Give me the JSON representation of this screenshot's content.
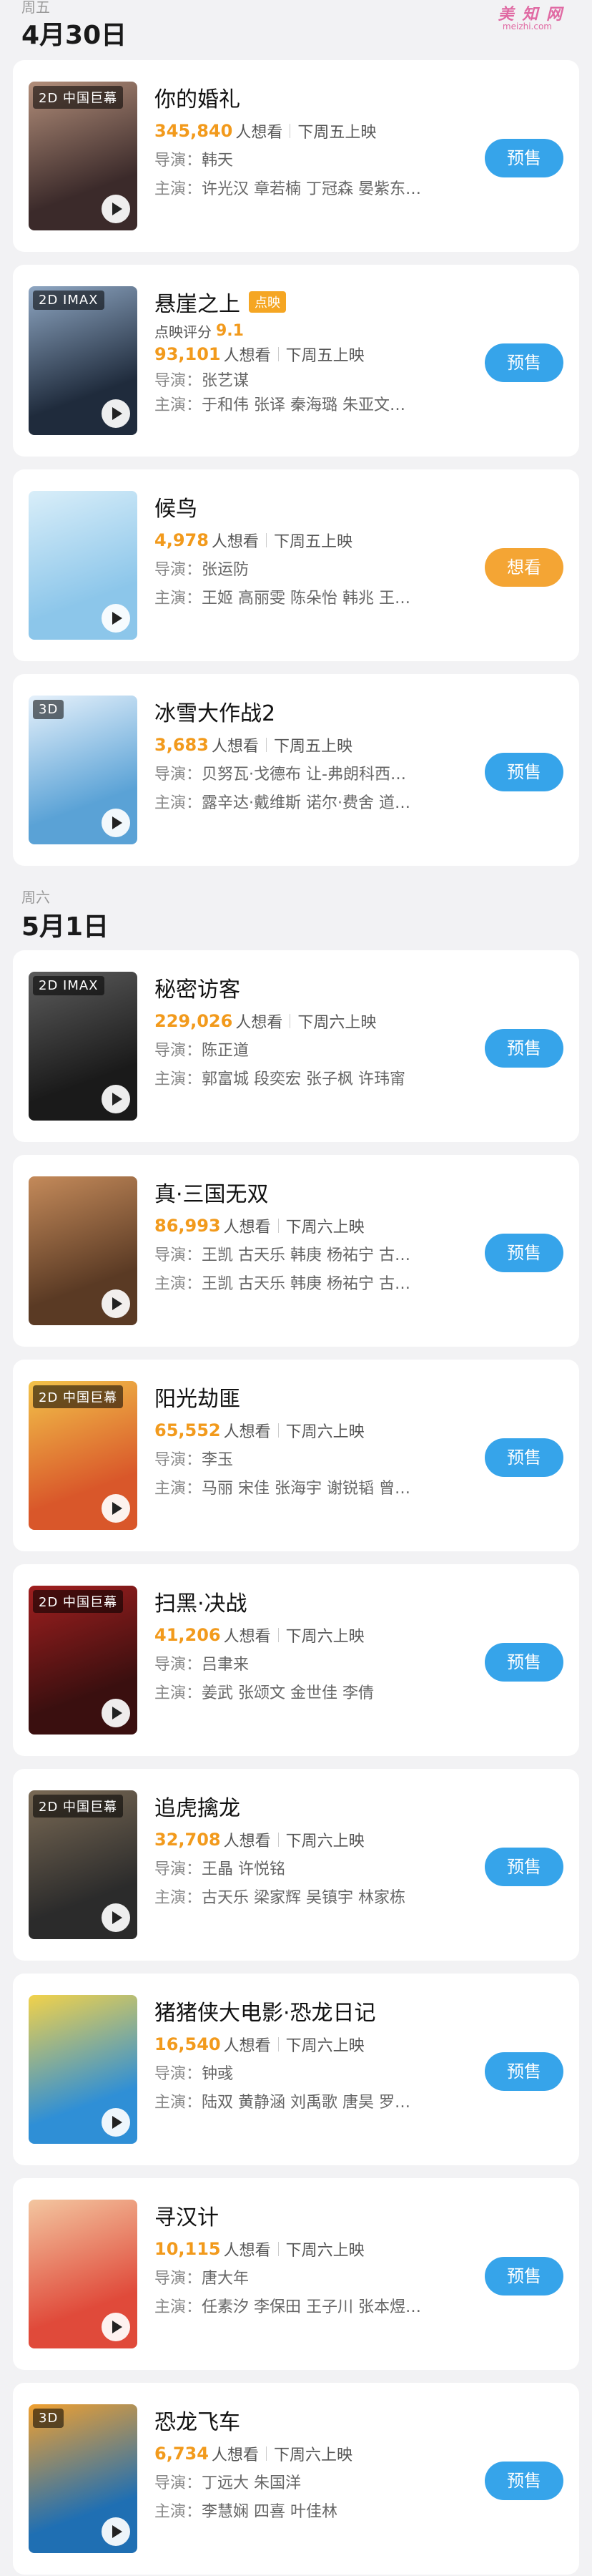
{
  "watermark": {
    "main": "美 知 网",
    "sub": "meizhi.com"
  },
  "days": [
    {
      "weekday": "周五",
      "date": "4月30日",
      "movies": [
        {
          "title": "你的婚礼",
          "badge": "2D 中国巨幕",
          "tag": "",
          "score_label": "",
          "score": "",
          "want_count": "345,840",
          "want_suffix": "人想看",
          "release": "下周五上映",
          "director_label": "导演：",
          "director": "韩天",
          "cast_label": "主演：",
          "cast": "许光汉 章若楠 丁冠森 晏紫东…",
          "button": "预售",
          "poster_colors": [
            "#3b2a2a",
            "#b28e7a"
          ]
        },
        {
          "title": "悬崖之上",
          "badge": "2D IMAX",
          "tag": "点映",
          "score_label": "点映评分",
          "score": "9.1",
          "want_count": "93,101",
          "want_suffix": "人想看",
          "release": "下周五上映",
          "director_label": "导演：",
          "director": "张艺谋",
          "cast_label": "主演：",
          "cast": "于和伟 张译 秦海璐 朱亚文…",
          "button": "预售",
          "poster_colors": [
            "#1f2b3c",
            "#8ea6c2"
          ]
        },
        {
          "title": "候鸟",
          "badge": "",
          "tag": "",
          "score_label": "",
          "score": "",
          "want_count": "4,978",
          "want_suffix": "人想看",
          "release": "下周五上映",
          "director_label": "导演：",
          "director": "张运防",
          "cast_label": "主演：",
          "cast": "王姬 高丽雯 陈朵怡 韩兆 王…",
          "button": "想看",
          "poster_colors": [
            "#8cc6ea",
            "#d9eef9"
          ]
        },
        {
          "title": "冰雪大作战2",
          "badge": "3D",
          "tag": "",
          "score_label": "",
          "score": "",
          "want_count": "3,683",
          "want_suffix": "人想看",
          "release": "下周五上映",
          "director_label": "导演：",
          "director": "贝努瓦·戈德布 让-弗朗科西…",
          "cast_label": "主演：",
          "cast": "露辛达·戴维斯 诺尔·费舍 道…",
          "button": "预售",
          "poster_colors": [
            "#5aa2d6",
            "#e6f1fb"
          ]
        }
      ]
    },
    {
      "weekday": "周六",
      "date": "5月1日",
      "movies": [
        {
          "title": "秘密访客",
          "badge": "2D IMAX",
          "tag": "",
          "score_label": "",
          "score": "",
          "want_count": "229,026",
          "want_suffix": "人想看",
          "release": "下周六上映",
          "director_label": "导演：",
          "director": "陈正道",
          "cast_label": "主演：",
          "cast": "郭富城 段奕宏 张子枫 许玮甯",
          "button": "预售",
          "poster_colors": [
            "#1a1a1a",
            "#5c5c5c"
          ]
        },
        {
          "title": "真·三国无双",
          "badge": "",
          "tag": "",
          "score_label": "",
          "score": "",
          "want_count": "86,993",
          "want_suffix": "人想看",
          "release": "下周六上映",
          "director_label": "导演：",
          "director": "王凯 古天乐 韩庚 杨祐宁 古…",
          "cast_label": "主演：",
          "cast": "王凯 古天乐 韩庚 杨祐宁 古…",
          "button": "预售",
          "poster_colors": [
            "#5a3a24",
            "#c48a5a"
          ]
        },
        {
          "title": "阳光劫匪",
          "badge": "2D 中国巨幕",
          "tag": "",
          "score_label": "",
          "score": "",
          "want_count": "65,552",
          "want_suffix": "人想看",
          "release": "下周六上映",
          "director_label": "导演：",
          "director": "李玉",
          "cast_label": "主演：",
          "cast": "马丽 宋佳 张海宇 谢锐韬 曾…",
          "button": "预售",
          "poster_colors": [
            "#d9572a",
            "#f2c34a"
          ]
        },
        {
          "title": "扫黑·决战",
          "badge": "2D 中国巨幕",
          "tag": "",
          "score_label": "",
          "score": "",
          "want_count": "41,206",
          "want_suffix": "人想看",
          "release": "下周六上映",
          "director_label": "导演：",
          "director": "吕聿来",
          "cast_label": "主演：",
          "cast": "姜武 张颂文 金世佳 李倩",
          "button": "预售",
          "poster_colors": [
            "#3a0f0f",
            "#a01f1f"
          ]
        },
        {
          "title": "追虎擒龙",
          "badge": "2D 中国巨幕",
          "tag": "",
          "score_label": "",
          "score": "",
          "want_count": "32,708",
          "want_suffix": "人想看",
          "release": "下周六上映",
          "director_label": "导演：",
          "director": "王晶 许悦铭",
          "cast_label": "主演：",
          "cast": "古天乐 梁家辉 吴镇宇 林家栋",
          "button": "预售",
          "poster_colors": [
            "#2b2b2b",
            "#7a6a55"
          ]
        },
        {
          "title": "猪猪侠大电影·恐龙日记",
          "badge": "",
          "tag": "",
          "score_label": "",
          "score": "",
          "want_count": "16,540",
          "want_suffix": "人想看",
          "release": "下周六上映",
          "director_label": "导演：",
          "director": "钟彧",
          "cast_label": "主演：",
          "cast": "陆双 黄静涵 刘禹歌 唐昊 罗…",
          "button": "预售",
          "poster_colors": [
            "#2f8fd6",
            "#f2d24a"
          ]
        },
        {
          "title": "寻汉计",
          "badge": "",
          "tag": "",
          "score_label": "",
          "score": "",
          "want_count": "10,115",
          "want_suffix": "人想看",
          "release": "下周六上映",
          "director_label": "导演：",
          "director": "唐大年",
          "cast_label": "主演：",
          "cast": "任素汐 李保田 王子川 张本煜…",
          "button": "预售",
          "poster_colors": [
            "#e04a3a",
            "#f3c6a0"
          ]
        },
        {
          "title": "恐龙飞车",
          "badge": "3D",
          "tag": "",
          "score_label": "",
          "score": "",
          "want_count": "6,734",
          "want_suffix": "人想看",
          "release": "下周六上映",
          "director_label": "导演：",
          "director": "丁远大 朱国洋",
          "cast_label": "主演：",
          "cast": "李慧娴 四喜 叶佳林",
          "button": "预售",
          "poster_colors": [
            "#1f6fb3",
            "#f0a030"
          ]
        }
      ]
    }
  ]
}
